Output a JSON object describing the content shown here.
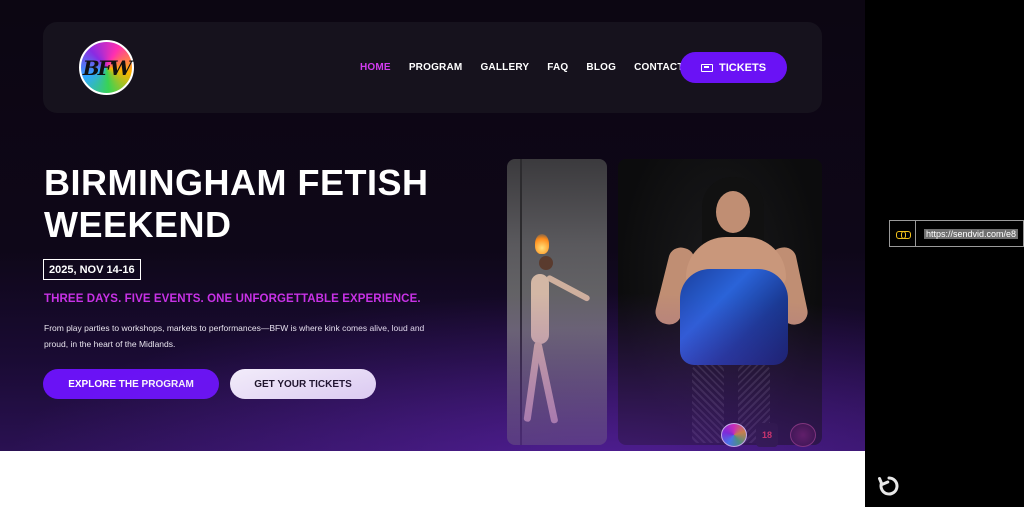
{
  "nav": {
    "logo_text": "BFW",
    "links": [
      {
        "label": "HOME",
        "active": true
      },
      {
        "label": "PROGRAM",
        "active": false
      },
      {
        "label": "GALLERY",
        "active": false
      },
      {
        "label": "FAQ",
        "active": false
      },
      {
        "label": "BLOG",
        "active": false
      },
      {
        "label": "CONTACT",
        "active": false
      }
    ],
    "tickets_label": "TICKETS"
  },
  "hero": {
    "title": "BIRMINGHAM FETISH WEEKEND",
    "date": "2025, NOV 14-16",
    "tagline": "THREE DAYS. FIVE EVENTS. ONE UNFORGETTABLE EXPERIENCE.",
    "description": "From play parties to workshops, markets to performances—BFW is where kink comes alive, loud and proud, in the heart of the Midlands.",
    "primary_cta": "EXPLORE THE PROGRAM",
    "secondary_cta": "GET YOUR TICKETS"
  },
  "sponsors": {
    "badge_2_text": "18"
  },
  "share": {
    "url": "https://sendvid.com/e8"
  },
  "colors": {
    "accent": "#6a12f5",
    "tagline": "#c832e6",
    "active_nav": "#d23cf0",
    "background": "#0e0718",
    "link_icon": "#f3c21b"
  }
}
